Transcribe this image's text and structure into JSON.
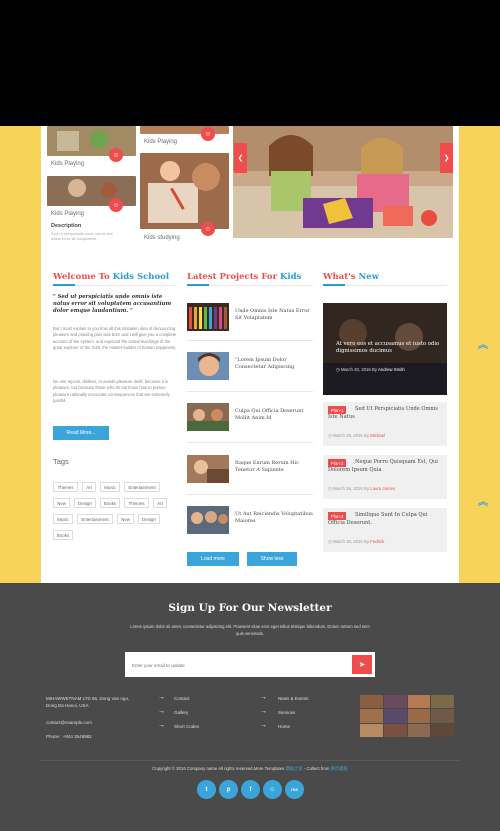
{
  "gallery": {
    "captions": [
      "Kids Playing",
      "Kids Playing",
      "Kids Playing",
      "Kids studying"
    ],
    "description_title": "Description",
    "description_text": "Sed ut perspiciatis unde omnis iste natus error sit voluptatem."
  },
  "hero": {
    "prev": "❮",
    "next": "❯"
  },
  "welcome": {
    "title_a": "Welcome To ",
    "title_b": "Kids School",
    "quote": "\" Sed ut perspiciatis unde omnis iste natus error sit voluptatem accusantium dolor emque laudantium. \"",
    "para1": "But I must explain to you how all this mistaken idea of denouncing pleasure and praising pain was born and I will give you a complete account of the system, and expound the actual teachings of the great explorer of the truth, the master-builder of human happiness.",
    "para2": "No one rejects, dislikes, or avoids pleasure itself, because it is pleasure, but because those who do not know how to pursue pleasure rationally encounter consequences that are extremely painful.",
    "read_more": "Read More..."
  },
  "tags": {
    "title": "Tags",
    "items": [
      "Themes",
      "Art",
      "Music",
      "Entertainment",
      "New",
      "Design",
      "Books",
      "Themes",
      "Art",
      "Music",
      "Entertainment",
      "New",
      "Design",
      "Books"
    ]
  },
  "projects": {
    "title_a": "Latest Projects For ",
    "title_b": "Kids",
    "items": [
      "Unde Omnis Iste Natus Error Sit Voluptatem",
      "\"Lorem Ipsum Dolor Consectetur Adipiscing",
      "Culpa Qui Officia Deserunt Mollit Anim Id",
      "Itaque Earum Rerum Hic Tenetur A Sapiente",
      "Ut Aut Reiciendis Voluptatibus Maiores"
    ],
    "load_more": "Load more",
    "show_less": "Show less"
  },
  "news": {
    "title_a": "What's ",
    "title_b": "New",
    "feature": {
      "title": "At vero eos et accusamus et iusto odio dignissimos ducimus",
      "date": "March 20, 2016",
      "by_prefix": "By",
      "author": "Andrew Smith"
    },
    "cards": [
      {
        "plan": "Plan-1",
        "title": "Sed Ut Perspiciatis Unde Omnis Iste Natus",
        "date": "March 25, 2016",
        "by_prefix": "By",
        "author": "Michael"
      },
      {
        "plan": "Plan-2",
        "title": "Neque Porro Quisquam Est, Qui Dolorem Ipsum Quia",
        "date": "March 26, 2016",
        "by_prefix": "By",
        "author": "Laura James"
      },
      {
        "plan": "Plan-3",
        "title": "Similique Sunt In Culpa Qui Officia Deserunt.",
        "date": "March 30, 2016",
        "by_prefix": "By",
        "author": "Fedrick"
      }
    ]
  },
  "newsletter": {
    "title": "Sign Up For Our Newsletter",
    "subtitle": "Lorem ipsum dolor sit amet, consectetur adipiscing elit. Praesent vitae eros eget tellus tristique bibendum. Donec rutrum sed sem quis venenatis.",
    "placeholder": "Enter your email to update"
  },
  "footer": {
    "address_line1": "MIHAWWETNAM LTD 66, Dong Van ngo,",
    "address_line2": "Dong Da Hanoi, USA",
    "email": "contact@example.com",
    "phone": "Phone : +844 3549982",
    "links_col1": [
      "Contact",
      "Gallery",
      "Short Codes"
    ],
    "links_col2": [
      "News & Events",
      "Services",
      "Home"
    ],
    "copyright": "Copyright © 2016 Company name All rights reserved.More Templates",
    "copyright_link1": "模板之家",
    "copyright_mid": " - Collect from ",
    "copyright_link2": "网页模板",
    "social": [
      "t",
      "p",
      "f",
      "☺",
      "rss"
    ]
  },
  "colors": {
    "accent_red": "#ef4d4d",
    "accent_blue": "#2a9bd5",
    "background_yellow": "#f7d35a",
    "footer_gray": "#4a4a4a"
  }
}
